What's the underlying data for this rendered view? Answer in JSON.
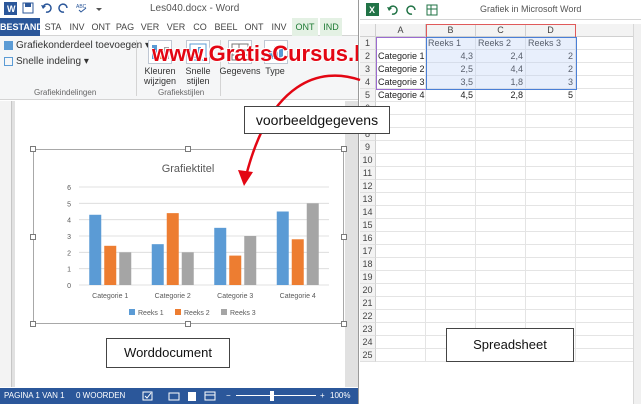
{
  "word": {
    "title": "Les040.docx - Word",
    "tabs": [
      {
        "label": "BESTAND",
        "type": "file"
      },
      {
        "label": "STA",
        "type": "tab"
      },
      {
        "label": "INV",
        "type": "tab"
      },
      {
        "label": "ONT",
        "type": "tab"
      },
      {
        "label": "PAG",
        "type": "tab"
      },
      {
        "label": "VER",
        "type": "tab"
      },
      {
        "label": "VER",
        "type": "tab"
      },
      {
        "label": "CO",
        "type": "tab"
      },
      {
        "label": "BEEL",
        "type": "tab"
      },
      {
        "label": "ONT",
        "type": "tab"
      },
      {
        "label": "INV",
        "type": "tab"
      },
      {
        "label": "ONT",
        "type": "ctx"
      },
      {
        "label": "IND",
        "type": "ctx"
      }
    ],
    "ribbon": {
      "add_element": "Grafiekonderdeel toevoegen",
      "quick_layout": "Snelle indeling",
      "group_layouts": "Grafiekindelingen",
      "change_colors": "Kleuren wijzigen",
      "quick_styles": "Snelle stijlen",
      "group_styles": "Grafiekstijlen",
      "data": "Gegevens",
      "type": "Type"
    },
    "watermark": "www.GratisCursus.be",
    "status": {
      "page": "PAGINA 1 VAN 1",
      "words": "0 WOORDEN",
      "zoom": "100%"
    }
  },
  "chart_data": {
    "type": "bar",
    "title": "Grafiektitel",
    "categories": [
      "Categorie 1",
      "Categorie 2",
      "Categorie 3",
      "Categorie 4"
    ],
    "series": [
      {
        "name": "Reeks 1",
        "color": "#5b9bd5",
        "values": [
          4.3,
          2.5,
          3.5,
          4.5
        ]
      },
      {
        "name": "Reeks 2",
        "color": "#ed7d31",
        "values": [
          2.4,
          4.4,
          1.8,
          2.8
        ]
      },
      {
        "name": "Reeks 3",
        "color": "#a5a5a5",
        "values": [
          2,
          2,
          3,
          5
        ]
      }
    ],
    "yticks": [
      0,
      1,
      2,
      3,
      4,
      5,
      6
    ],
    "ylim": [
      0,
      6
    ],
    "grid": true,
    "legend": "bottom"
  },
  "excel": {
    "title": "Grafiek in Microsoft Word",
    "columns": [
      "A",
      "B",
      "C",
      "D"
    ],
    "header_row": [
      "",
      "Reeks 1",
      "Reeks 2",
      "Reeks 3"
    ],
    "rows": [
      [
        "Categorie 1",
        "4,3",
        "2,4",
        "2"
      ],
      [
        "Categorie 2",
        "2,5",
        "4,4",
        "2"
      ],
      [
        "Categorie 3",
        "3,5",
        "1,8",
        "3"
      ],
      [
        "Categorie 4",
        "4,5",
        "2,8",
        "5"
      ]
    ],
    "row_numbers": [
      "1",
      "2",
      "3",
      "4",
      "5",
      "6",
      "7",
      "8",
      "9",
      "10",
      "11",
      "12",
      "13",
      "14",
      "15",
      "16",
      "17",
      "18",
      "19",
      "20",
      "21",
      "22",
      "23",
      "24",
      "25"
    ]
  },
  "annotations": {
    "sample_data": "voorbeeldgegevens",
    "word_doc": "Worddocument",
    "spreadsheet": "Spreadsheet"
  }
}
